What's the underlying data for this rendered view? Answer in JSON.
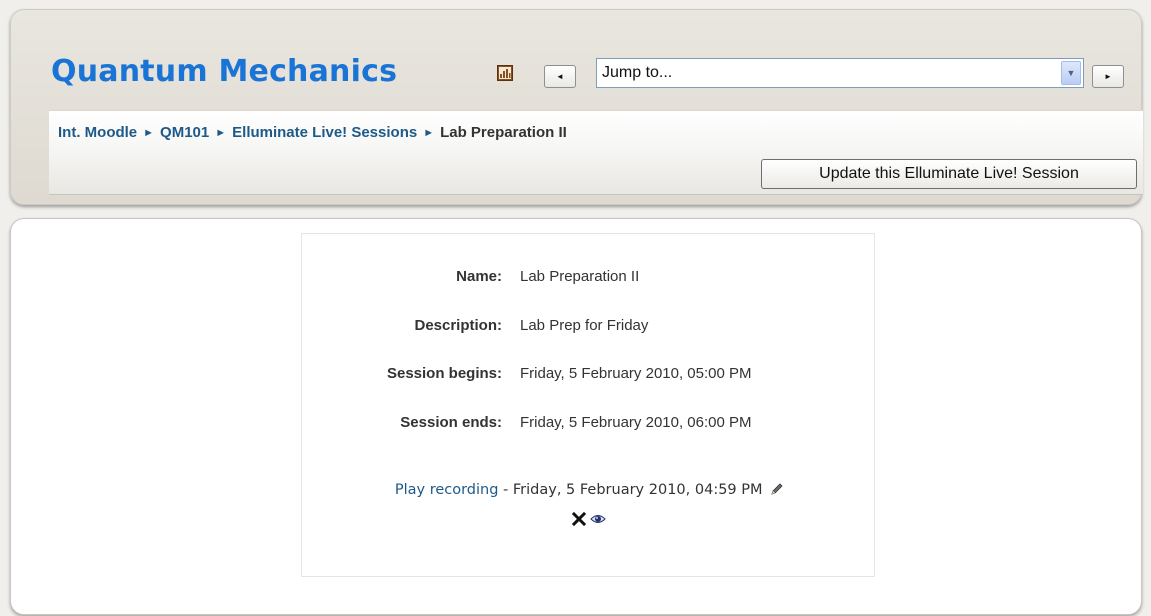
{
  "header": {
    "course_title": "Quantum Mechanics",
    "jump_to": {
      "selected": "Jump to..."
    },
    "breadcrumb": {
      "items": [
        "Int. Moodle",
        "QM101",
        "Elluminate Live! Sessions"
      ],
      "current": "Lab Preparation II",
      "separator": "►"
    },
    "update_button_label": "Update this Elluminate Live! Session",
    "prev_arrow": "◄",
    "next_arrow": "►",
    "select_arrow": "▼"
  },
  "session": {
    "fields": [
      {
        "label": "Name:",
        "value": "Lab Preparation II"
      },
      {
        "label": "Description:",
        "value": "Lab Prep for Friday"
      },
      {
        "label": "Session begins:",
        "value": "Friday, 5 February 2010, 05:00 PM"
      },
      {
        "label": "Session ends:",
        "value": "Friday, 5 February 2010, 06:00 PM"
      }
    ],
    "recording": {
      "link_label": "Play recording",
      "separator": " - ",
      "timestamp": "Friday, 5 February 2010, 04:59 PM"
    }
  },
  "icons": {
    "report": "report-icon",
    "edit": "edit-icon",
    "delete": "delete-icon",
    "visibility": "eye-icon"
  },
  "colors": {
    "title_blue": "#1a74d6",
    "link_blue": "#1e5a88",
    "panel_beige": "#e4e1da"
  }
}
